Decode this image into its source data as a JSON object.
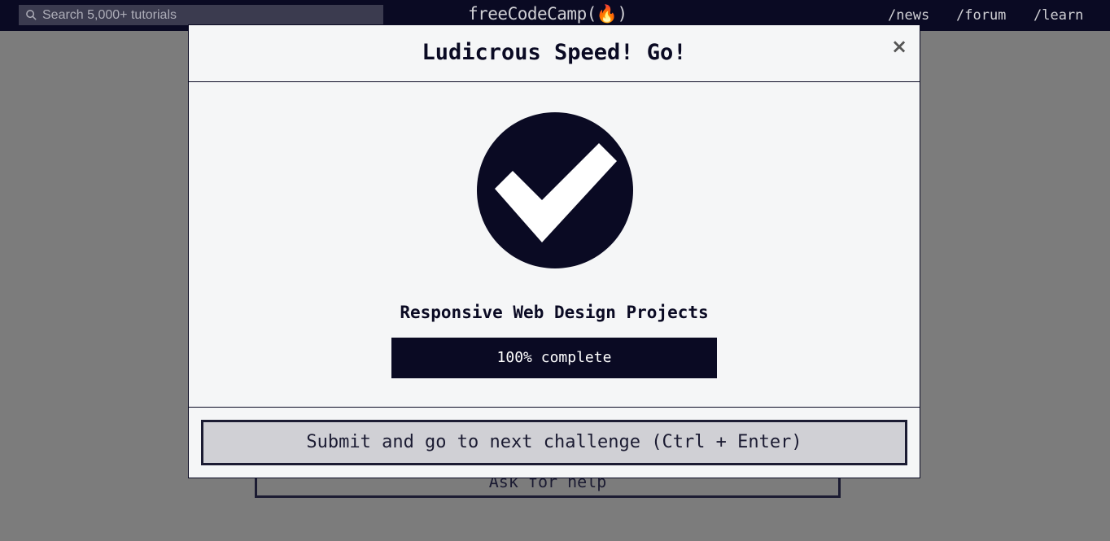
{
  "navbar": {
    "search_placeholder": "Search 5,000+ tutorials",
    "brand": "freeCodeCamp(🔥)",
    "links": [
      "/news",
      "/forum",
      "/learn"
    ]
  },
  "background": {
    "help_button": "Ask for help"
  },
  "modal": {
    "title": "Ludicrous Speed! Go!",
    "close_label": "×",
    "block_name": "Responsive Web Design Projects",
    "progress_percent": 100,
    "progress_label": "100% complete",
    "submit_label": "Submit and go to next challenge (Ctrl + Enter)"
  },
  "colors": {
    "dark": "#0a0a23",
    "overlay": "#7c7c7c",
    "button_bg": "#d0d0d5",
    "modal_bg": "#f5f6f7"
  }
}
